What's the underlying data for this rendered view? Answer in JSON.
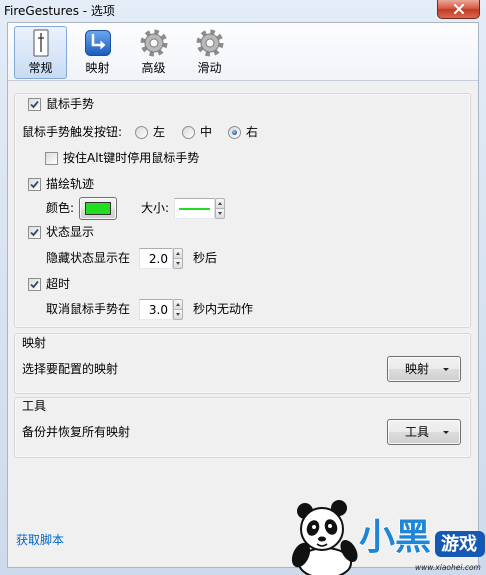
{
  "window": {
    "title": "FireGestures - 选项",
    "close_icon": "close-icon"
  },
  "tabs": [
    {
      "label": "常规",
      "icon": "mouse-settings-icon",
      "selected": true
    },
    {
      "label": "映射",
      "icon": "mapping-arrow-icon",
      "selected": false
    },
    {
      "label": "高级",
      "icon": "gear-icon",
      "selected": false
    },
    {
      "label": "滑动",
      "icon": "gear-icon",
      "selected": false
    }
  ],
  "mouse_gestures": {
    "enabled_label": "鼠标手势",
    "enabled": true,
    "trigger": {
      "label": "鼠标手势触发按钮:",
      "options": [
        {
          "label": "左",
          "selected": false
        },
        {
          "label": "中",
          "selected": false
        },
        {
          "label": "右",
          "selected": true
        }
      ]
    },
    "disable_with_alt": {
      "label": "按住Alt键时停用鼠标手势",
      "checked": false
    },
    "trail": {
      "label": "描绘轨迹",
      "checked": true,
      "color_label": "颜色:",
      "color": "#22dd22",
      "size_label": "大小:",
      "size": 2
    },
    "status": {
      "label": "状态显示",
      "checked": true,
      "hide_prefix": "隐藏状态显示在",
      "hide_value": "2.0",
      "hide_suffix": "秒后"
    },
    "timeout": {
      "label": "超时",
      "checked": true,
      "cancel_prefix": "取消鼠标手势在",
      "cancel_value": "3.0",
      "cancel_suffix": "秒内无动作"
    }
  },
  "mapping": {
    "caption": "映射",
    "description": "选择要配置的映射",
    "button_label": "映射",
    "button_icon": "dropdown-arrow-icon"
  },
  "tools": {
    "caption": "工具",
    "description": "备份并恢复所有映射",
    "button_label": "工具",
    "button_icon": "dropdown-arrow-icon"
  },
  "footer": {
    "get_scripts_link": "获取脚本"
  },
  "watermark": {
    "logo": "panda-logo-icon",
    "brand_main": "小黑",
    "brand_badge": "游戏",
    "url": "www.xiaohei.com"
  },
  "colors": {
    "link": "#0066cc"
  }
}
